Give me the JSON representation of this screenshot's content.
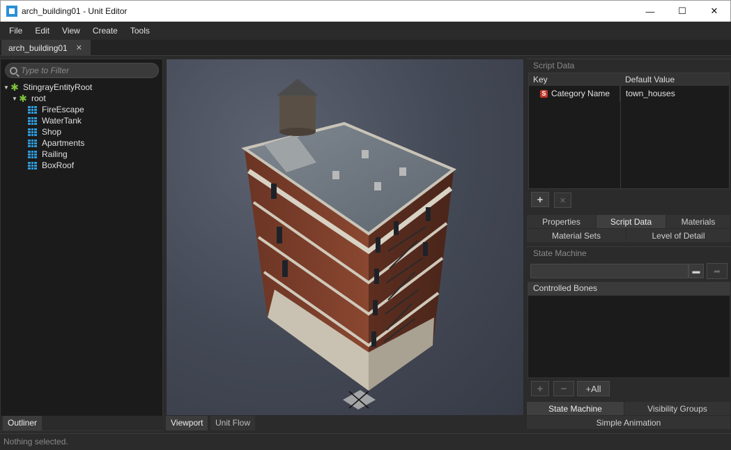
{
  "window": {
    "title": "arch_building01 - Unit Editor",
    "controls": {
      "minimize": "—",
      "maximize": "☐",
      "close": "✕"
    }
  },
  "menu": [
    "File",
    "Edit",
    "View",
    "Create",
    "Tools"
  ],
  "document_tab": {
    "label": "arch_building01",
    "close": "✕"
  },
  "outliner": {
    "filter_placeholder": "Type to Filter",
    "tree": {
      "root_label": "StingrayEntityRoot",
      "child_label": "root",
      "items": [
        "FireEscape",
        "WaterTank",
        "Shop",
        "Apartments",
        "Railing",
        "BoxRoof"
      ]
    },
    "tab_label": "Outliner"
  },
  "viewport_tabs": [
    "Viewport",
    "Unit Flow"
  ],
  "script_data": {
    "section_title": "Script Data",
    "col_key": "Key",
    "col_value": "Default Value",
    "rows": [
      {
        "icon": "S",
        "key": "Category Name",
        "value": "town_houses"
      }
    ],
    "add_symbol": "+",
    "remove_symbol": "✕"
  },
  "property_tabs": {
    "row1": [
      "Properties",
      "Script Data",
      "Materials"
    ],
    "row2": [
      "Material Sets",
      "Level of Detail"
    ],
    "active": "Script Data"
  },
  "state_machine": {
    "section_title": "State Machine",
    "path_value": "",
    "controlled_bones_header": "Controlled Bones",
    "add_symbol": "+",
    "remove_symbol": "−",
    "add_all_label": "+All"
  },
  "animation_tabs": {
    "row1": [
      "State Machine",
      "Visibility Groups"
    ],
    "row2": [
      "Simple Animation"
    ],
    "active": "State Machine"
  },
  "status": {
    "text": "Nothing selected."
  },
  "colors": {
    "accent_green": "#7cc23a",
    "accent_blue": "#2e9ad8",
    "panel_dark": "#1b1b1b",
    "panel": "#2b2b2b"
  }
}
